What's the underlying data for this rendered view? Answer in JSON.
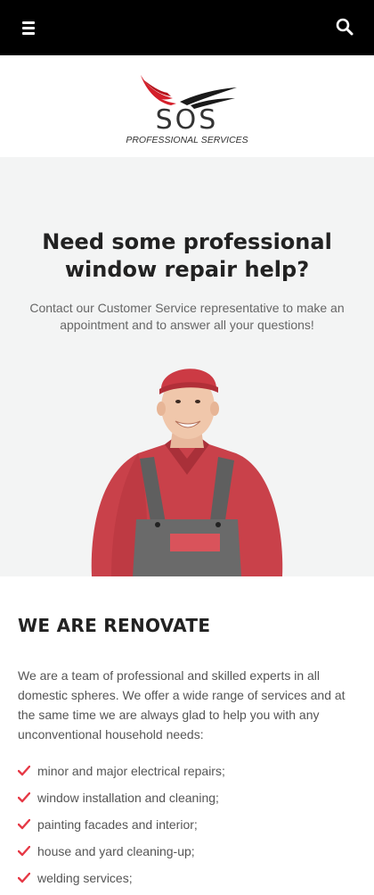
{
  "header": {
    "menu_icon": "hamburger-menu-icon",
    "search_icon": "search-icon"
  },
  "logo": {
    "wordmark": "SOS",
    "tagline": "PROFESSIONAL SERVICES",
    "colors": {
      "wing_red": "#d41f2a",
      "wing_dark": "#1a1a1a",
      "text": "#333333"
    }
  },
  "hero": {
    "title": "Need some professional window repair help?",
    "subtitle": "Contact our Customer Service representative to make an appointment and to answer all your questions!",
    "image": "worker-photo"
  },
  "about": {
    "title": "WE ARE RENOVATE",
    "text": "We are a team of professional and skilled experts in all domestic spheres. We offer a wide range of services and at the same time we are always glad to help you with any unconventional household needs:",
    "items": [
      "minor and major electrical repairs;",
      "window installation and cleaning;",
      "painting facades and interior;",
      "house and yard cleaning-up;",
      "welding services;"
    ],
    "check_icon": "check-icon",
    "accent_color": "#e63946"
  }
}
